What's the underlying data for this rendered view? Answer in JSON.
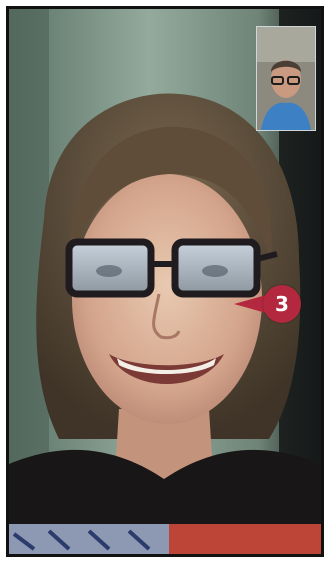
{
  "screen": {
    "type": "video-call",
    "main_video": "remote-participant-video",
    "self_view": "local-camera-preview"
  },
  "callout": {
    "number": "3",
    "color": "#b3283f"
  },
  "colors": {
    "frame_border": "#111111",
    "callout_fill": "#b3283f"
  }
}
